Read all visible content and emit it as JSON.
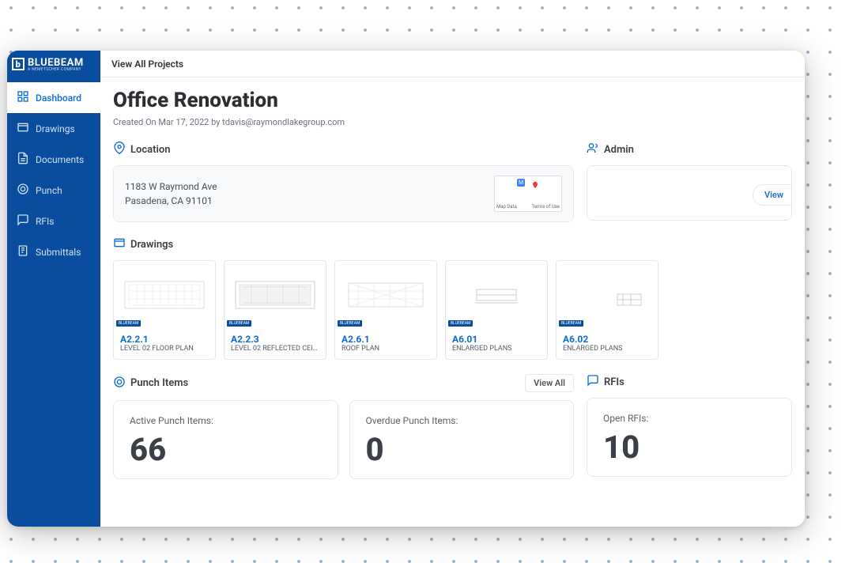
{
  "brand": {
    "name": "BLUEBEAM",
    "sub": "A NEMETSCHEK COMPANY"
  },
  "topbar": {
    "view_all_projects": "View All Projects"
  },
  "sidebar": {
    "items": [
      {
        "label": "Dashboard"
      },
      {
        "label": "Drawings"
      },
      {
        "label": "Documents"
      },
      {
        "label": "Punch"
      },
      {
        "label": "RFIs"
      },
      {
        "label": "Submittals"
      }
    ]
  },
  "page": {
    "title": "Office Renovation",
    "created": "Created On Mar 17, 2022 by tdavis@raymondlakegroup.com"
  },
  "location": {
    "label": "Location",
    "line1": "1183 W Raymond Ave",
    "line2": "Pasadena, CA 91101",
    "map_data": "Map Data",
    "terms": "Terms of Use"
  },
  "admin": {
    "label": "Admin",
    "view_button": "View"
  },
  "drawings": {
    "label": "Drawings",
    "items": [
      {
        "id": "A2.2.1",
        "desc": "LEVEL 02 FLOOR PLAN"
      },
      {
        "id": "A2.2.3",
        "desc": "LEVEL 02 REFLECTED CEIL..."
      },
      {
        "id": "A2.6.1",
        "desc": "ROOF PLAN"
      },
      {
        "id": "A6.01",
        "desc": "ENLARGED PLANS"
      },
      {
        "id": "A6.02",
        "desc": "ENLARGED PLANS"
      }
    ]
  },
  "punch": {
    "label": "Punch Items",
    "view_all": "View All",
    "active_label": "Active Punch Items:",
    "active_value": "66",
    "overdue_label": "Overdue Punch Items:",
    "overdue_value": "0"
  },
  "rfis": {
    "label": "RFIs",
    "open_label": "Open RFIs:",
    "open_value": "10"
  }
}
